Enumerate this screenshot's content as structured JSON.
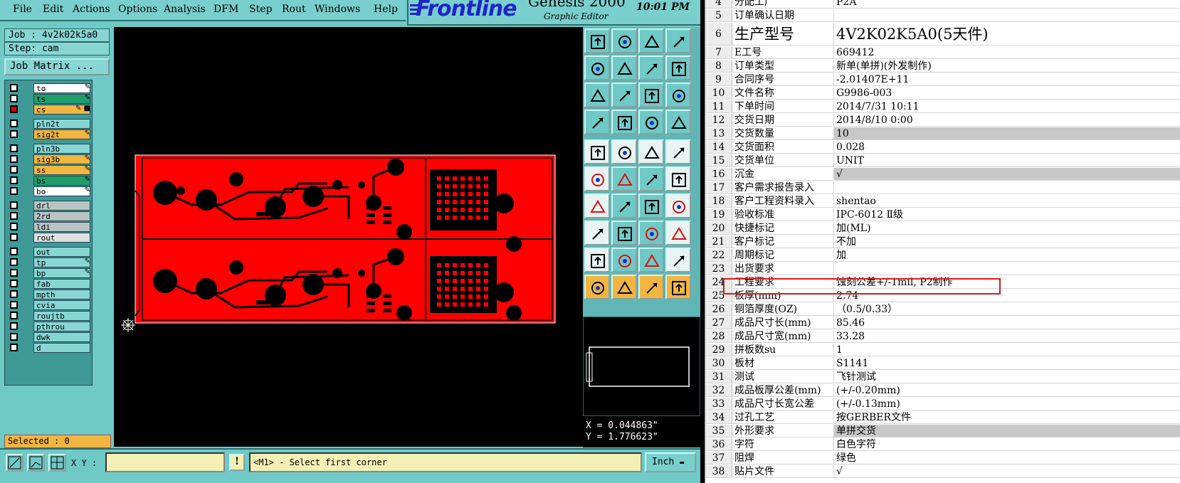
{
  "menu": [
    "File",
    "Edit",
    "Actions",
    "Options",
    "Analysis",
    "DFM",
    "Step",
    "Rout",
    "Windows",
    "Help"
  ],
  "logo": {
    "brand": "Frontline",
    "product": "Genesis 2000",
    "subtitle": "Graphic Editor",
    "time": "10:01 PM"
  },
  "job": {
    "job_label": "Job : 4v2k02k5a0",
    "step_label": "Step: cam",
    "matrix_button": "Job Matrix ..."
  },
  "layers": [
    {
      "name": "to",
      "color": "#ffffff"
    },
    {
      "name": "ts",
      "color": "#1f9e6b"
    },
    {
      "name": "cs",
      "color": "#f2b640"
    },
    {
      "name": "pln2t",
      "color": "#88d6d3"
    },
    {
      "name": "sig2t",
      "color": "#f2b640"
    },
    {
      "name": "pln3b",
      "color": "#88d6d3"
    },
    {
      "name": "sig3b",
      "color": "#f2b640"
    },
    {
      "name": "ss",
      "color": "#f2b640"
    },
    {
      "name": "bs",
      "color": "#1f9e6b"
    },
    {
      "name": "bo",
      "color": "#ffffff"
    },
    {
      "name": "drl",
      "color": "#b8c4c4"
    },
    {
      "name": "2rd",
      "color": "#b8c4c4"
    },
    {
      "name": "ldi",
      "color": "#b8c4c4"
    },
    {
      "name": "rout",
      "color": "#e0e0e0"
    },
    {
      "name": "out",
      "color": "#88d6d3"
    },
    {
      "name": "tp",
      "color": "#88d6d3"
    },
    {
      "name": "bp",
      "color": "#88d6d3"
    },
    {
      "name": "fab",
      "color": "#88d6d3"
    },
    {
      "name": "mpth",
      "color": "#88d6d3"
    },
    {
      "name": "cvia",
      "color": "#88d6d3"
    },
    {
      "name": "roujtb",
      "color": "#88d6d3"
    },
    {
      "name": "pthrou",
      "color": "#88d6d3"
    },
    {
      "name": "dwk",
      "color": "#88d6d3"
    },
    {
      "name": "d",
      "color": "#88d6d3"
    }
  ],
  "selected": "Selected : 0",
  "coords": {
    "x": "X = 0.044863\"",
    "y": "Y = 1.776623\""
  },
  "bottom": {
    "xy_label": "X Y :",
    "xy_value": "",
    "prompt": "<M1> - Select first corner",
    "unit": "Inch"
  },
  "colors": {
    "board": "#ff0000",
    "panel": "#6fc9c7",
    "accent_yellow": "#f2b640",
    "highlight": "#e01818"
  },
  "sheet": {
    "rows": [
      {
        "n": "4",
        "a": "分配工厂",
        "b": "P2A"
      },
      {
        "n": "5",
        "a": "订单确认日期",
        "b": ""
      },
      {
        "n": "6",
        "a": "生产型号",
        "b": "4V2K02K5A0(5天件)"
      },
      {
        "n": "7",
        "a": "E工号",
        "b": "669412"
      },
      {
        "n": "8",
        "a": "订单类型",
        "b": "新单(单拼)(外发制作)"
      },
      {
        "n": "9",
        "a": "合同序号",
        "b": "-2.01407E+11"
      },
      {
        "n": "10",
        "a": "文件名称",
        "b": "G9986-003"
      },
      {
        "n": "11",
        "a": "下单时间",
        "b": "2014/7/31 10:11"
      },
      {
        "n": "12",
        "a": "交货日期",
        "b": "2014/8/10 0:00"
      },
      {
        "n": "13",
        "a": "交货数量",
        "b": "10"
      },
      {
        "n": "14",
        "a": "交货面积",
        "b": "0.028"
      },
      {
        "n": "15",
        "a": "交货单位",
        "b": "UNIT"
      },
      {
        "n": "16",
        "a": "沉金",
        "b": "√"
      },
      {
        "n": "17",
        "a": "客户需求报告录入",
        "b": ""
      },
      {
        "n": "18",
        "a": "客户工程资料录入",
        "b": "shentao"
      },
      {
        "n": "19",
        "a": "验收标准",
        "b": "IPC-6012 Ⅱ级"
      },
      {
        "n": "20",
        "a": "快捷标记",
        "b": "加(ML)"
      },
      {
        "n": "21",
        "a": "客户标记",
        "b": "不加"
      },
      {
        "n": "22",
        "a": "周期标记",
        "b": "加"
      },
      {
        "n": "23",
        "a": "出货要求",
        "b": ""
      },
      {
        "n": "24",
        "a": "工程要求",
        "b": "蚀刻公差+/-1mil, P2制作"
      },
      {
        "n": "25",
        "a": "板厚(mm)",
        "b": "2.74"
      },
      {
        "n": "26",
        "a": "铜箔厚度(OZ)",
        "b": "（0.5/0.33）"
      },
      {
        "n": "27",
        "a": "成品尺寸长(mm)",
        "b": "85.46"
      },
      {
        "n": "28",
        "a": "成品尺寸宽(mm)",
        "b": "33.28"
      },
      {
        "n": "29",
        "a": "拼板数su",
        "b": "1"
      },
      {
        "n": "30",
        "a": "板材",
        "b": "S1141"
      },
      {
        "n": "31",
        "a": "测试",
        "b": "飞针测试"
      },
      {
        "n": "32",
        "a": "成品板厚公差(mm)",
        "b": "(+/-0.20mm)"
      },
      {
        "n": "33",
        "a": "成品尺寸长宽公差",
        "b": "(+/-0.13mm)"
      },
      {
        "n": "34",
        "a": "过孔工艺",
        "b": "按GERBER文件"
      },
      {
        "n": "35",
        "a": "外形要求",
        "b": "单拼交货"
      },
      {
        "n": "36",
        "a": "字符",
        "b": "白色字符"
      },
      {
        "n": "37",
        "a": "阻焊",
        "b": "绿色"
      },
      {
        "n": "38",
        "a": "贴片文件",
        "b": "√"
      }
    ]
  }
}
